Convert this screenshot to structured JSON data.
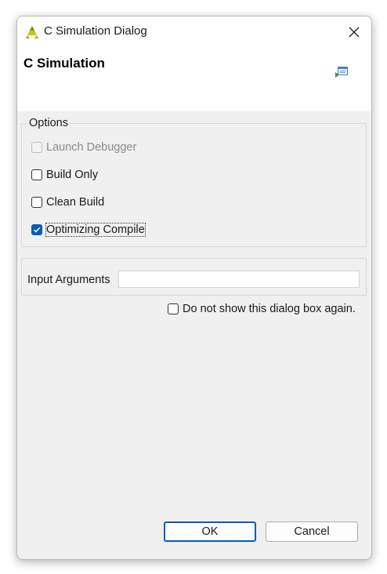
{
  "window": {
    "title": "C Simulation Dialog"
  },
  "header": {
    "title": "C Simulation"
  },
  "options": {
    "legend": "Options",
    "items": [
      {
        "label": "Launch Debugger",
        "checked": false,
        "disabled": true
      },
      {
        "label": "Build Only",
        "checked": false,
        "disabled": false
      },
      {
        "label": "Clean Build",
        "checked": false,
        "disabled": false
      },
      {
        "label": "Optimizing Compile",
        "checked": true,
        "disabled": false
      }
    ]
  },
  "arguments": {
    "label": "Input Arguments",
    "value": ""
  },
  "dont_show": {
    "label": "Do not show this dialog box again.",
    "checked": false
  },
  "buttons": {
    "ok": "OK",
    "cancel": "Cancel"
  },
  "colors": {
    "accent": "#0a5bb5",
    "dialog_bg": "#f0f0f0",
    "header_bg": "#ffffff",
    "logo_yellow": "#c8c21c"
  },
  "icons": {
    "app": "vitis-hls-logo-icon",
    "header": "simulation-run-icon",
    "close": "close-icon"
  }
}
